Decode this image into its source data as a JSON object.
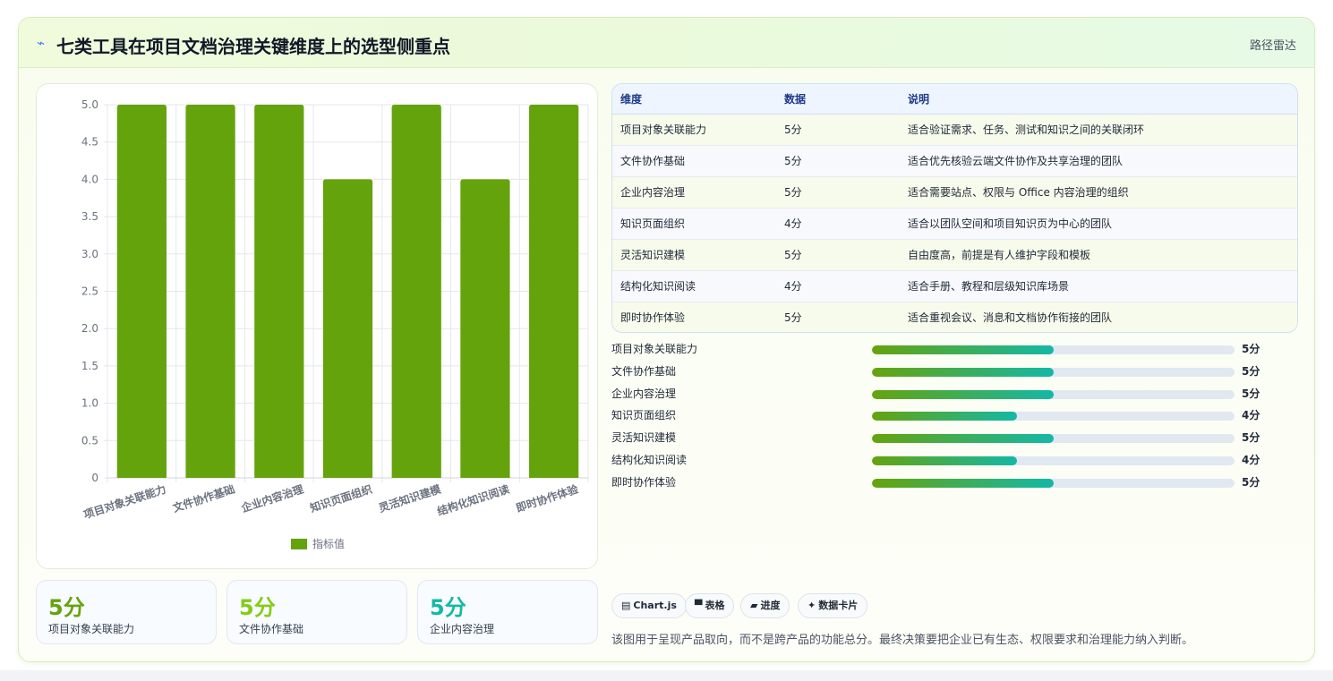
{
  "header": {
    "icon": "pulse-icon",
    "title": "七类工具在项目文档治理关键维度上的选型侧重点",
    "tag": "路径雷达"
  },
  "colors": {
    "bar": "#65a30d",
    "stat_green": "#65a30d",
    "stat_lime": "#84cc16",
    "stat_teal": "#14b8a6"
  },
  "chart_data": {
    "type": "bar",
    "categories": [
      "项目对象关联能力",
      "文件协作基础",
      "企业内容治理",
      "知识页面组织",
      "灵活知识建模",
      "结构化知识阅读",
      "即时协作体验"
    ],
    "series": [
      {
        "name": "指标值",
        "values": [
          5,
          5,
          5,
          4,
          5,
          4,
          5
        ]
      }
    ],
    "ylim": [
      0,
      5
    ],
    "yticks": [
      "0",
      "0.5",
      "1.0",
      "1.5",
      "2.0",
      "2.5",
      "3.0",
      "3.5",
      "4.0",
      "4.5",
      "5.0"
    ],
    "grid": true,
    "legend": "bottom"
  },
  "stats": [
    {
      "value": "5分",
      "label": "项目对象关联能力"
    },
    {
      "value": "5分",
      "label": "文件协作基础"
    },
    {
      "value": "5分",
      "label": "企业内容治理"
    }
  ],
  "table": {
    "headers": [
      "维度",
      "数据",
      "说明"
    ],
    "rows": [
      [
        "项目对象关联能力",
        "5分",
        "适合验证需求、任务、测试和知识之间的关联闭环"
      ],
      [
        "文件协作基础",
        "5分",
        "适合优先核验云端文件协作及共享治理的团队"
      ],
      [
        "企业内容治理",
        "5分",
        "适合需要站点、权限与 Office 内容治理的组织"
      ],
      [
        "知识页面组织",
        "4分",
        "适合以团队空间和项目知识页为中心的团队"
      ],
      [
        "灵活知识建模",
        "5分",
        "自由度高，前提是有人维护字段和模板"
      ],
      [
        "结构化知识阅读",
        "4分",
        "适合手册、教程和层级知识库场景"
      ],
      [
        "即时协作体验",
        "5分",
        "适合重视会议、消息和文档协作衔接的团队"
      ]
    ]
  },
  "progress": [
    {
      "label": "项目对象关联能力",
      "value": "5分",
      "fraction": 0.5
    },
    {
      "label": "文件协作基础",
      "value": "5分",
      "fraction": 0.5
    },
    {
      "label": "企业内容治理",
      "value": "5分",
      "fraction": 0.5
    },
    {
      "label": "知识页面组织",
      "value": "4分",
      "fraction": 0.4
    },
    {
      "label": "灵活知识建模",
      "value": "5分",
      "fraction": 0.5
    },
    {
      "label": "结构化知识阅读",
      "value": "4分",
      "fraction": 0.4
    },
    {
      "label": "即时协作体验",
      "value": "5分",
      "fraction": 0.5
    }
  ],
  "tags": [
    {
      "icon": "chart-icon",
      "label": "Chart.js"
    },
    {
      "icon": "table-icon",
      "label": "表格"
    },
    {
      "icon": "progress-icon",
      "label": "进度"
    },
    {
      "icon": "sparkle-icon",
      "label": "数据卡片"
    }
  ],
  "footnote": "该图用于呈现产品取向，而不是跨产品的功能总分。最终决策要把企业已有生态、权限要求和治理能力纳入判断。"
}
